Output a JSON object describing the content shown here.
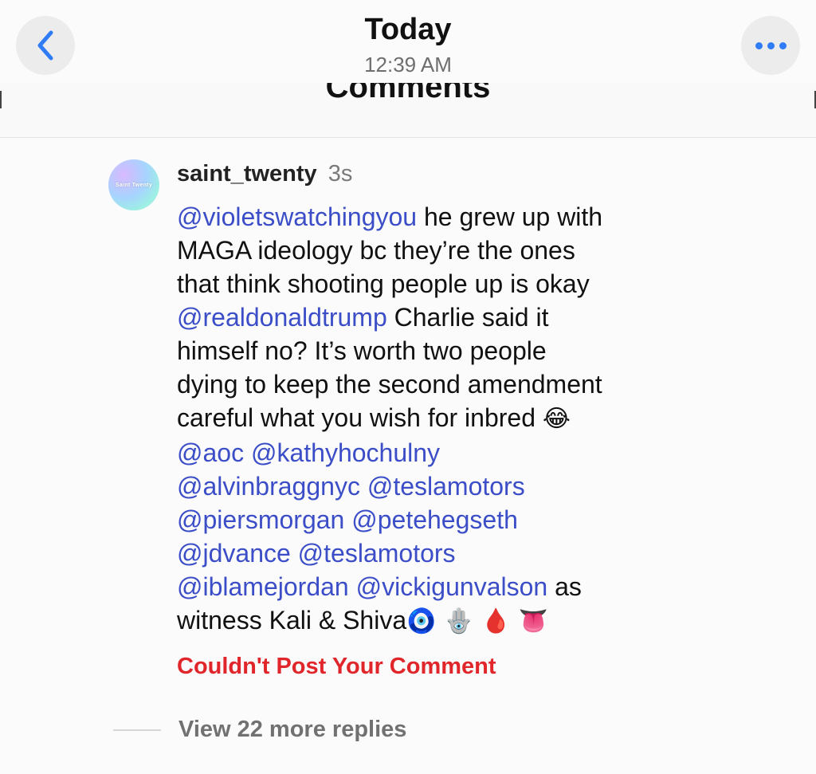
{
  "header": {
    "title": "Today",
    "subtitle": "12:39 AM",
    "back_icon": "chevron-left-icon",
    "more_icon": "ellipsis-icon",
    "accent_color": "#2f7cf6"
  },
  "comments_heading": "Comments",
  "comment": {
    "avatar_text": "Saint Twenty",
    "username": "saint_twenty",
    "time": "3s",
    "lines": [
      [
        {
          "t": "@violetswatchingyou",
          "m": true
        },
        {
          "t": " he grew up with",
          "m": false
        }
      ],
      [
        {
          "t": "MAGA ideology bc they’re the ones",
          "m": false
        }
      ],
      [
        {
          "t": "that think shooting people up is okay",
          "m": false
        }
      ],
      [
        {
          "t": "@realdonaldtrump",
          "m": true
        },
        {
          "t": " Charlie said it",
          "m": false
        }
      ],
      [
        {
          "t": "himself no? It’s worth two people",
          "m": false
        }
      ],
      [
        {
          "t": "dying to keep the second amendment",
          "m": false
        }
      ],
      [
        {
          "t": "careful what you wish for inbred ",
          "m": false
        },
        {
          "t": "😂",
          "e": true
        }
      ],
      [
        {
          "t": "@aoc",
          "m": true
        },
        {
          "t": " ",
          "m": false
        },
        {
          "t": "@kathyhochulny",
          "m": true
        }
      ],
      [
        {
          "t": "@alvinbraggnyc",
          "m": true
        },
        {
          "t": " ",
          "m": false
        },
        {
          "t": "@teslamotors",
          "m": true
        }
      ],
      [
        {
          "t": "@piersmorgan",
          "m": true
        },
        {
          "t": " ",
          "m": false
        },
        {
          "t": "@petehegseth",
          "m": true
        }
      ],
      [
        {
          "t": "@jdvance",
          "m": true
        },
        {
          "t": " ",
          "m": false
        },
        {
          "t": "@teslamotors",
          "m": true
        }
      ],
      [
        {
          "t": "@iblamejordan",
          "m": true
        },
        {
          "t": " ",
          "m": false
        },
        {
          "t": "@vickigunvalson",
          "m": true
        },
        {
          "t": " as",
          "m": false
        }
      ],
      [
        {
          "t": "witness Kali & Shiva",
          "m": false
        },
        {
          "t": "🧿 🪬 🩸 👅",
          "e": true
        }
      ]
    ],
    "error": "Couldn't Post Your Comment",
    "mention_color": "#3b4ec7",
    "error_color": "#e0262b"
  },
  "replies": {
    "label": "View 22 more replies"
  }
}
